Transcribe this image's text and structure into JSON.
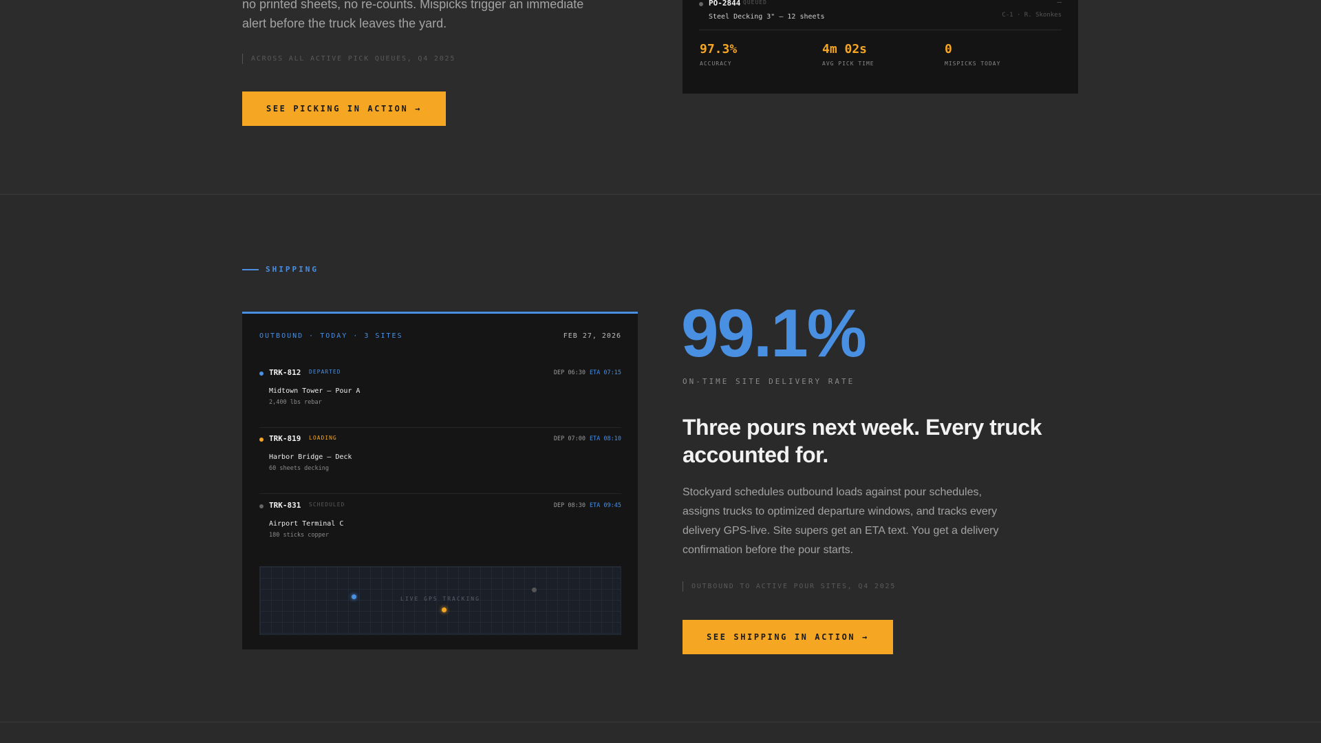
{
  "picking": {
    "body_text": "no printed sheets, no re-counts. Mispicks trigger an immediate alert before the truck leaves the yard.",
    "footnote": "ACROSS ALL ACTIVE PICK QUEUES, Q4 2025",
    "cta_label": "SEE PICKING IN ACTION →",
    "card": {
      "row": {
        "id": "PO-2844",
        "status": "QUEUED",
        "dash": "—",
        "description": "Steel Decking 3\" — 12 sheets",
        "meta": "C-1 · R. Skonkes"
      },
      "stats": [
        {
          "value": "97.3%",
          "label": "ACCURACY"
        },
        {
          "value": "4m 02s",
          "label": "AVG PICK TIME"
        },
        {
          "value": "0",
          "label": "MISPICKS TODAY"
        }
      ]
    }
  },
  "shipping": {
    "eyebrow": "SHIPPING",
    "card": {
      "title": "OUTBOUND · TODAY · 3 SITES",
      "date": "FEB 27, 2026",
      "trucks": [
        {
          "id": "TRK-812",
          "status": "DEPARTED",
          "status_color": "#4a90e2",
          "dot_color": "#4a90e2",
          "dep": "DEP 06:30",
          "eta": "ETA 07:15",
          "destination": "Midtown Tower — Pour A",
          "load": "2,400 lbs rebar"
        },
        {
          "id": "TRK-819",
          "status": "LOADING",
          "status_color": "#f5a623",
          "dot_color": "#f5a623",
          "dep": "DEP 07:00",
          "eta": "ETA 08:10",
          "destination": "Harbor Bridge — Deck",
          "load": "60 sheets decking"
        },
        {
          "id": "TRK-831",
          "status": "SCHEDULED",
          "status_color": "#5a5a5a",
          "dot_color": "#666666",
          "dep": "DEP 08:30",
          "eta": "ETA 09:45",
          "destination": "Airport Terminal C",
          "load": "180 sticks copper"
        }
      ],
      "map_label": "LIVE GPS TRACKING"
    },
    "big_stat": "99.1%",
    "big_stat_label": "ON-TIME SITE DELIVERY RATE",
    "heading": "Three pours next week. Every truck accounted for.",
    "body_text": "Stockyard schedules outbound loads against pour schedules, assigns trucks to optimized departure windows, and tracks every delivery GPS-live. Site supers get an ETA text. You get a delivery confirmation before the pour starts.",
    "footnote": "OUTBOUND TO ACTIVE POUR SITES, Q4 2025",
    "cta_label": "SEE SHIPPING IN ACTION →"
  },
  "colors": {
    "accent_orange": "#f5a623",
    "accent_blue": "#4a90e2",
    "background": "#2a2a2a",
    "card": "#151515"
  }
}
